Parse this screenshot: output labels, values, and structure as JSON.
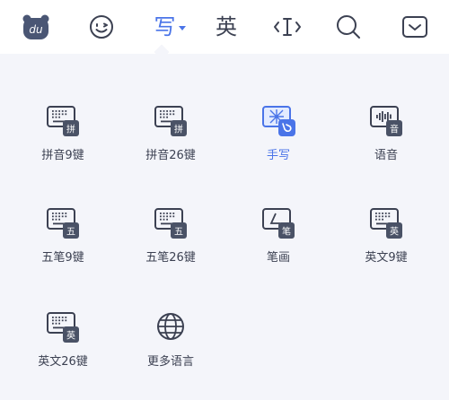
{
  "toolbar": {
    "logo_text": "du",
    "items": [
      {
        "icon": "paw-logo-icon"
      },
      {
        "icon": "smiley-icon"
      },
      {
        "label": "写",
        "icon": "dropdown-caret-icon"
      },
      {
        "label": "英"
      },
      {
        "icon": "cursor-move-icon"
      },
      {
        "icon": "search-icon"
      },
      {
        "icon": "collapse-keyboard-icon"
      }
    ]
  },
  "colors": {
    "accent": "#4a74e8",
    "text": "#3c4152",
    "background": "#f4f5fa"
  },
  "keyboards": [
    {
      "label": "拼音9键",
      "badge": "拼",
      "icon": "keyboard-icon"
    },
    {
      "label": "拼音26键",
      "badge": "拼",
      "icon": "keyboard-icon"
    },
    {
      "label": "手写",
      "icon": "handwriting-icon",
      "selected": true
    },
    {
      "label": "语音",
      "badge": "音",
      "icon": "voice-icon"
    },
    {
      "label": "五笔9键",
      "badge": "五",
      "icon": "keyboard-icon"
    },
    {
      "label": "五笔26键",
      "badge": "五",
      "icon": "keyboard-icon"
    },
    {
      "label": "笔画",
      "badge": "笔",
      "icon": "stroke-icon"
    },
    {
      "label": "英文9键",
      "badge": "英",
      "icon": "keyboard-icon"
    },
    {
      "label": "英文26键",
      "badge": "英",
      "icon": "keyboard-icon"
    },
    {
      "label": "更多语言",
      "icon": "globe-icon"
    }
  ]
}
